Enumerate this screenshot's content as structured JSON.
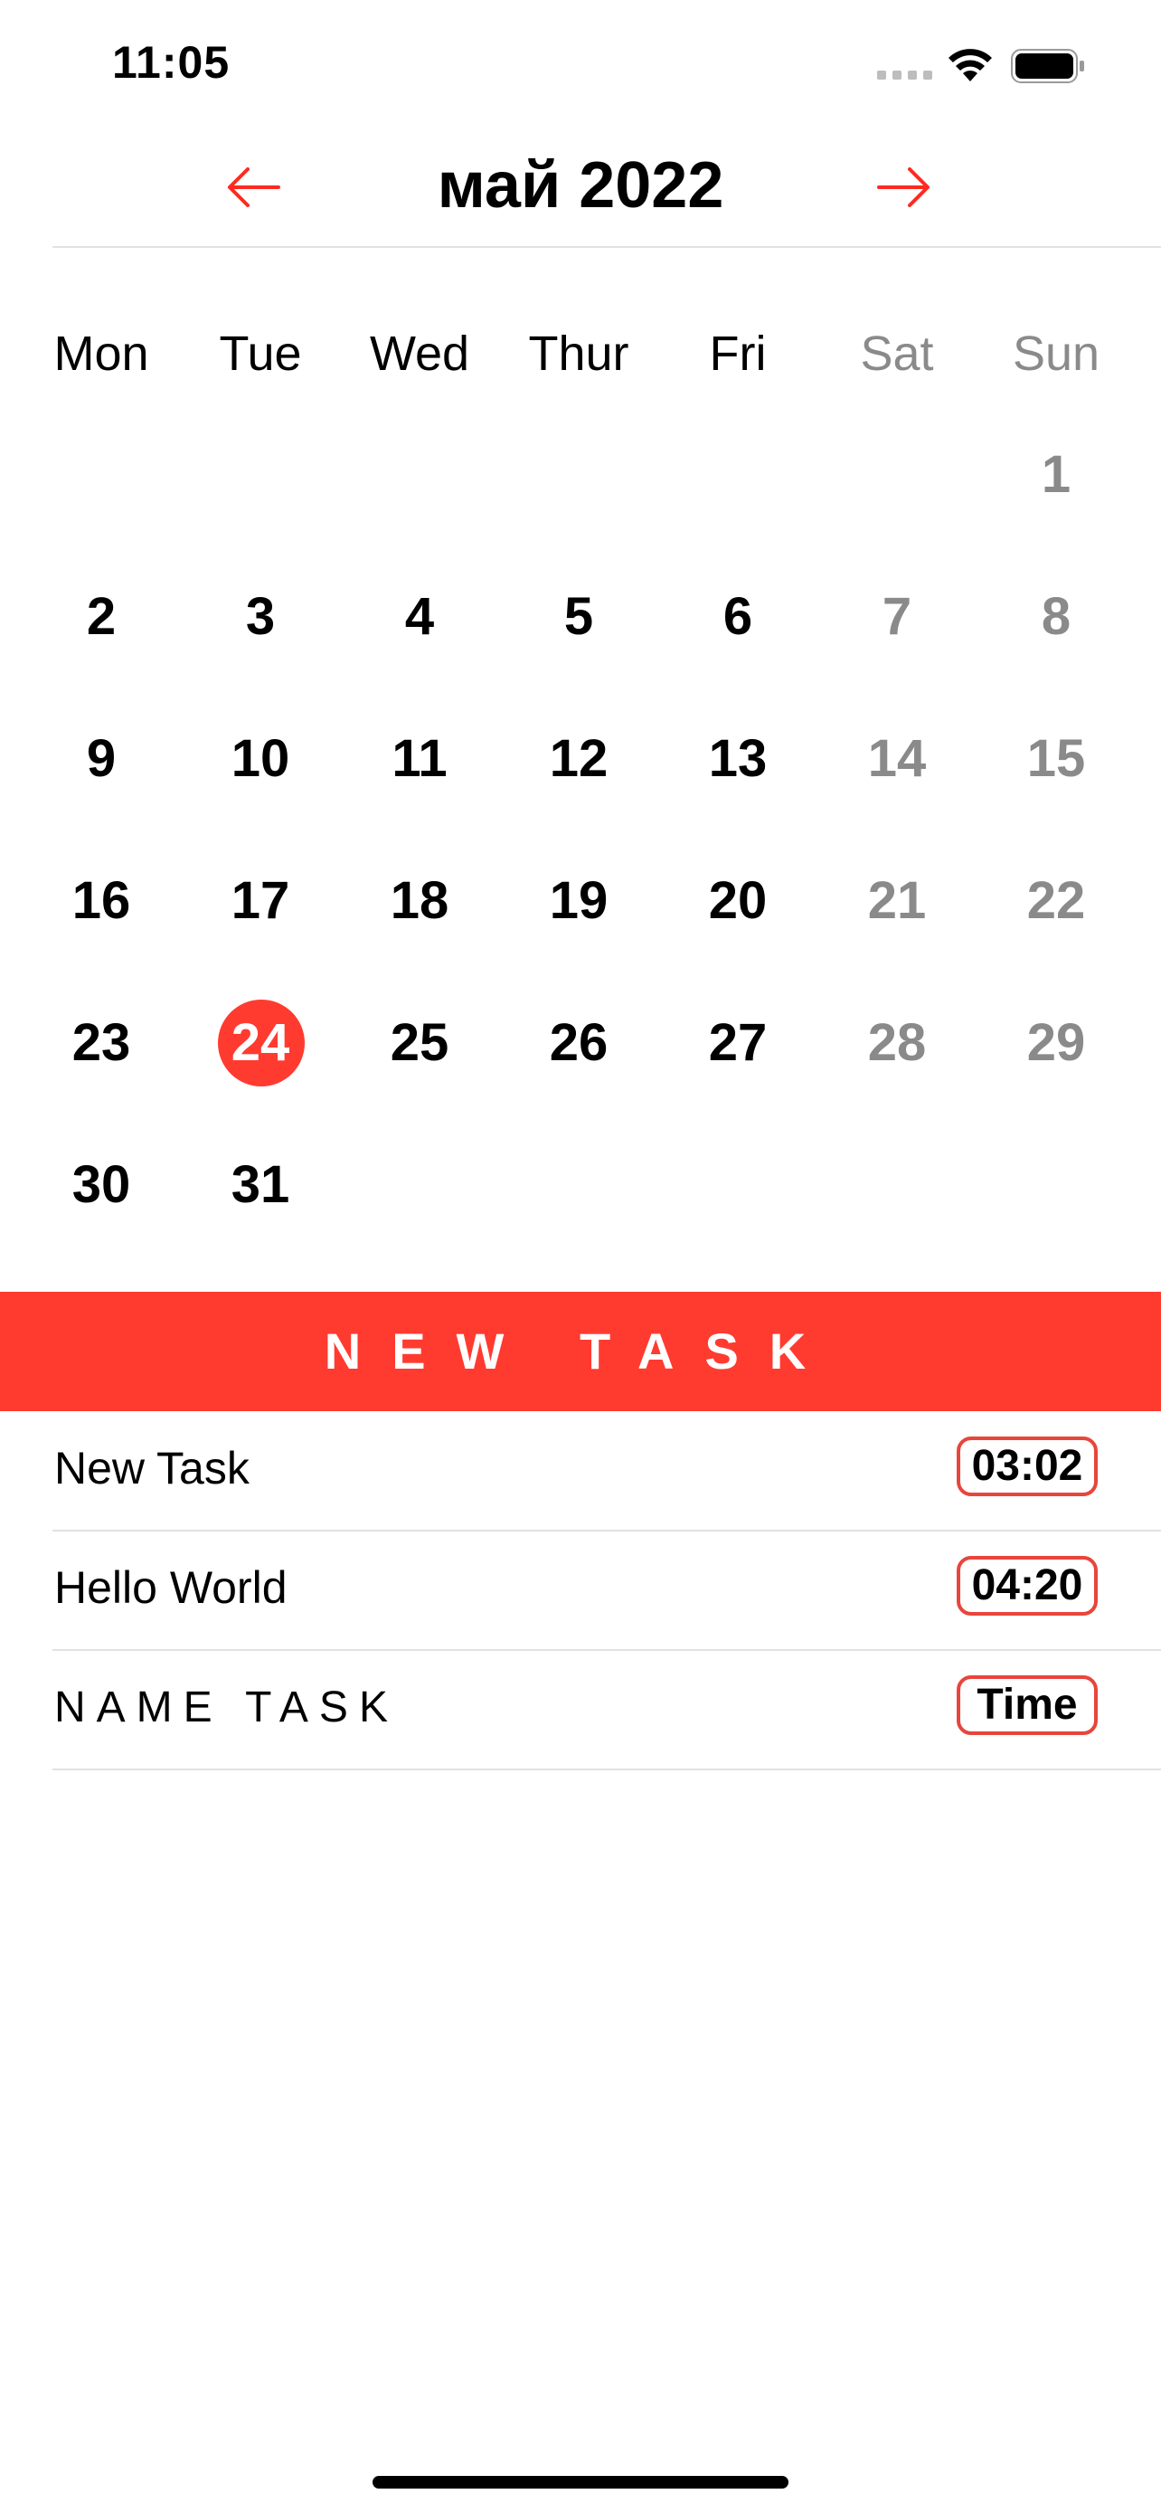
{
  "status_bar": {
    "time": "11:05"
  },
  "header": {
    "month_title": "май 2022",
    "prev_icon": "arrow-left-icon",
    "next_icon": "arrow-right-icon",
    "accent_color": "#ff3b30"
  },
  "calendar": {
    "weekdays": [
      "Mon",
      "Tue",
      "Wed",
      "Thur",
      "Fri",
      "Sat",
      "Sun"
    ],
    "weeks": [
      [
        "",
        "",
        "",
        "",
        "",
        "",
        "1"
      ],
      [
        "2",
        "3",
        "4",
        "5",
        "6",
        "7",
        "8"
      ],
      [
        "9",
        "10",
        "11",
        "12",
        "13",
        "14",
        "15"
      ],
      [
        "16",
        "17",
        "18",
        "19",
        "20",
        "21",
        "22"
      ],
      [
        "23",
        "24",
        "25",
        "26",
        "27",
        "28",
        "29"
      ],
      [
        "30",
        "31",
        "",
        "",
        "",
        "",
        ""
      ]
    ],
    "selected_day": "24"
  },
  "new_task_button": {
    "label": "NEW TASK"
  },
  "tasks": [
    {
      "name": "New Task",
      "time": "03:02"
    },
    {
      "name": "Hello World",
      "time": "04:20"
    }
  ],
  "new_task_row": {
    "name": "NAME TASK",
    "time": "Time"
  }
}
